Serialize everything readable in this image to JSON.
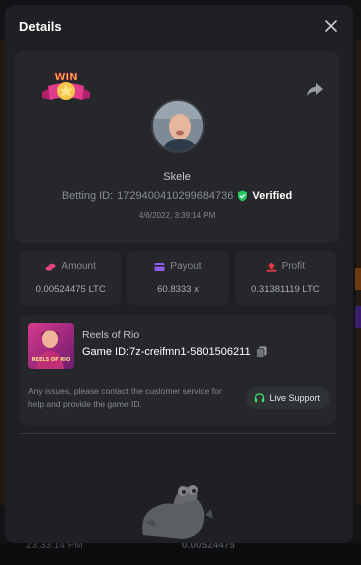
{
  "background": {
    "time_text": "23:33:14 PM",
    "amount_text": "0.00524475"
  },
  "modal": {
    "title": "Details"
  },
  "player": {
    "username": "Skele",
    "betting_id_label": "Betting ID:",
    "betting_id": "1729400410299684736",
    "verified_label": "Verified",
    "timestamp": "4/6/2022, 3:39:14 PM",
    "win_badge_text": "WIN"
  },
  "stats": [
    {
      "label": "Amount",
      "value": "0.00524475 LTC",
      "icon": "coins-icon",
      "color": "#e0457b"
    },
    {
      "label": "Payout",
      "value": "60.8333 x",
      "icon": "card-icon",
      "color": "#8f5cf5"
    },
    {
      "label": "Profit",
      "value": "0.31381119 LTC",
      "icon": "profit-icon",
      "color": "#e5394a"
    }
  ],
  "game": {
    "name": "Reels of Rio",
    "id_label": "Game ID:",
    "id_value": "7z-creifmn1-5801506211",
    "thumb_text": "REELS OF RIO"
  },
  "support": {
    "message": "Any issues, please contact the customer service for help and provide the game ID.",
    "button_label": "Live Support"
  },
  "colors": {
    "modal_bg": "#1e2023",
    "card_bg": "#25272a",
    "verified_green": "#22c55e",
    "support_green": "#3fdc6b"
  }
}
